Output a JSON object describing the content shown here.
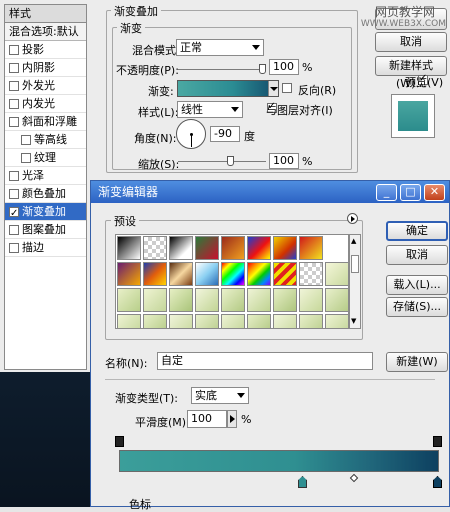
{
  "styles_panel": {
    "title": "样式",
    "blend_options": "混合选项:默认",
    "items": [
      {
        "label": "投影",
        "checked": false,
        "sub": false,
        "selected": false
      },
      {
        "label": "内阴影",
        "checked": false,
        "sub": false,
        "selected": false
      },
      {
        "label": "外发光",
        "checked": false,
        "sub": false,
        "selected": false
      },
      {
        "label": "内发光",
        "checked": false,
        "sub": false,
        "selected": false
      },
      {
        "label": "斜面和浮雕",
        "checked": false,
        "sub": false,
        "selected": false
      },
      {
        "label": "等高线",
        "checked": false,
        "sub": true,
        "selected": false
      },
      {
        "label": "纹理",
        "checked": false,
        "sub": true,
        "selected": false
      },
      {
        "label": "光泽",
        "checked": false,
        "sub": false,
        "selected": false
      },
      {
        "label": "颜色叠加",
        "checked": false,
        "sub": false,
        "selected": false
      },
      {
        "label": "渐变叠加",
        "checked": true,
        "sub": false,
        "selected": true
      },
      {
        "label": "图案叠加",
        "checked": false,
        "sub": false,
        "selected": false
      },
      {
        "label": "描边",
        "checked": false,
        "sub": false,
        "selected": false
      }
    ]
  },
  "gradient_overlay": {
    "section_title": "渐变叠加",
    "group_title": "渐变",
    "blend_mode_label": "混合模式:",
    "blend_mode_value": "正常",
    "opacity_label": "不透明度(P):",
    "opacity_value": "100",
    "opacity_unit": "%",
    "gradient_label": "渐变:",
    "reverse_label": "反向(R)",
    "reverse_checked": false,
    "style_label": "样式(L):",
    "style_value": "线性",
    "align_label": "与图层对齐(I)",
    "align_checked": true,
    "angle_label": "角度(N):",
    "angle_value": "-90",
    "angle_unit": "度",
    "scale_label": "缩放(S):",
    "scale_value": "100",
    "scale_unit": "%"
  },
  "right_buttons": {
    "cancel": "取消",
    "new_style": "新建样式(W)...",
    "preview": "预览(V)",
    "preview_checked": true
  },
  "watermark": {
    "line1": "网页教学网",
    "line2": "WWW.WEB3X.COM"
  },
  "editor": {
    "title": "渐变编辑器",
    "presets_label": "预设",
    "ok": "确定",
    "cancel": "取消",
    "load": "载入(L)...",
    "save": "存储(S)...",
    "name_label": "名称(N):",
    "name_value": "自定",
    "new_button": "新建(W)",
    "type_label": "渐变类型(T):",
    "type_value": "实底",
    "smooth_label": "平滑度(M):",
    "smooth_value": "100",
    "smooth_unit": "%",
    "stops_label": "色标"
  },
  "colors": {
    "selection": "#316ac5",
    "titlebar": "#2c62c3",
    "gradient_start": "#3b9e9a",
    "gradient_end": "#0d4060"
  }
}
